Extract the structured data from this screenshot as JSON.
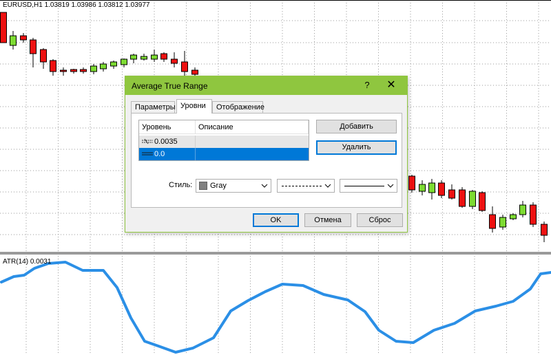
{
  "chart": {
    "symbol_label": "EURUSD,H1  1.03819 1.03986 1.03812 1.03977",
    "indicator_label": "ATR(14) 0.0031",
    "bull_color": "#7ddb32",
    "bear_color": "#ee1111",
    "atr_color": "#2b8fe6"
  },
  "dialog": {
    "title": "Average True Range",
    "help_glyph": "?",
    "close_glyph": "✕",
    "tabs": [
      {
        "label": "Параметры",
        "active": false
      },
      {
        "label": "Уровни",
        "active": true
      },
      {
        "label": "Отображение",
        "active": false
      }
    ],
    "levels": {
      "columns": [
        "Уровень",
        "Описание"
      ],
      "rows": [
        {
          "value": "0.0035",
          "description": "",
          "selected": false
        },
        {
          "value": "0.0",
          "description": "",
          "selected": true
        }
      ]
    },
    "add_button": "Добавить",
    "delete_button": "Удалить",
    "style_label": "Стиль:",
    "color_value": "Gray",
    "ok_button": "OK",
    "cancel_button": "Отмена",
    "reset_button": "Сброс",
    "accent_color": "#8fc63f",
    "selection_color": "#0078d7"
  }
}
